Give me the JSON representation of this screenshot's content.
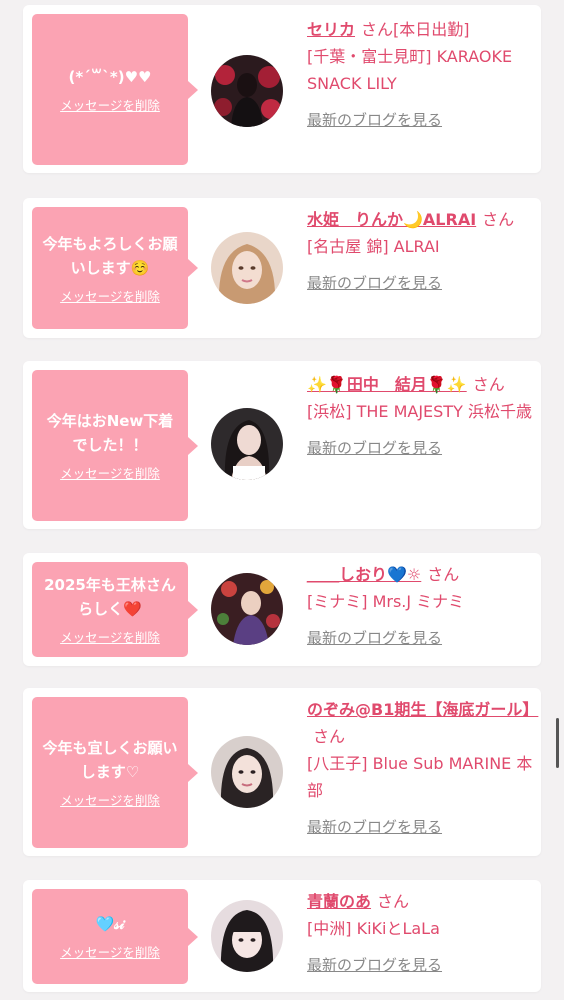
{
  "cards": [
    {
      "message": "(*´꒳`*)♥♥",
      "delete_label": "メッセージを削除",
      "name": "セリカ",
      "suffix": "さん[本日出勤]",
      "place": "[千葉・富士見町] KARAOKE SNACK LILY",
      "blog_label": "最新のブログを見る"
    },
    {
      "message": "今年もよろしくお願いします☺️",
      "delete_label": "メッセージを削除",
      "name": "水姫　りんか🌙ALRAI",
      "suffix": "さん",
      "place": "[名古屋 錦] ALRAI",
      "blog_label": "最新のブログを見る"
    },
    {
      "message": "今年はおNew下着でした！！",
      "delete_label": "メッセージを削除",
      "name": "✨🌹田中　結月🌹✨",
      "suffix": "さん",
      "place": "[浜松] THE MAJESTY 浜松千歳",
      "blog_label": "最新のブログを見る"
    },
    {
      "message": "2025年も王林さんらしく❤️",
      "delete_label": "メッセージを削除",
      "name": "＿＿しおり💙☼",
      "suffix": "さん",
      "place": "[ミナミ] Mrs.J ミナミ",
      "blog_label": "最新のブログを見る"
    },
    {
      "message": "今年も宜しくお願いします♡",
      "delete_label": "メッセージを削除",
      "name": "のぞみ@B1期生【海底ガール】",
      "suffix": "さん",
      "place": "[八王子] Blue Sub MARINE 本部",
      "blog_label": "最新のブログを見る"
    },
    {
      "message": "🩵𝓈𝒾",
      "delete_label": "メッセージを削除",
      "name": "青蘭のあ",
      "suffix": "さん",
      "place": "[中洲] KiKiとLaLa",
      "blog_label": "最新のブログを見る"
    }
  ],
  "colors": {
    "accent": "#e04a6d",
    "bubble": "#fba3b3",
    "background": "#f3f1f2"
  }
}
